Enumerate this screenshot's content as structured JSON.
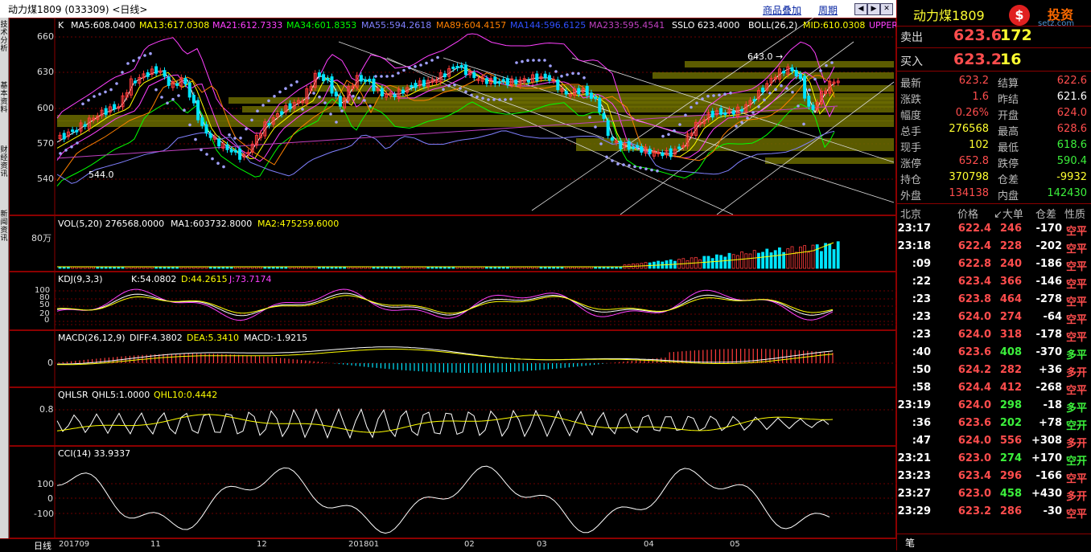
{
  "window": {
    "title": "动力煤1809 (033309) <日线>",
    "btn_overlay": "商品叠加",
    "btn_period": "周期",
    "nav_icons": [
      "prev-icon",
      "next-icon",
      "zoom-icon",
      "close-icon"
    ]
  },
  "left_tabs": [
    "技术分析",
    "基本资料",
    "财经资讯",
    "新闻资讯"
  ],
  "price_panel": {
    "prefix": "K",
    "ma5": "MA5:608.0400",
    "ma13": "MA13:617.0308",
    "ma21": "MA21:612.7333",
    "ma34": "MA34:601.8353",
    "ma55": "MA55:594.2618",
    "ma89": "MA89:604.4157",
    "ma144": "MA144:596.6125",
    "ma233": "MA233:595.4541",
    "sslo": "SSLO 623.4000",
    "boll": "BOLL(26,2)",
    "mid": "MID:610.0308",
    "upper": "UPPER",
    "y_ticks": [
      "660",
      "630",
      "600",
      "570",
      "540"
    ],
    "annot_high": "643.0 →",
    "annot_low": "544.0"
  },
  "vol_panel": {
    "label": "VOL(5,20) 276568.0000",
    "ma1": "MA1:603732.8000",
    "ma2": "MA2:475259.6000",
    "y_tick": "80万"
  },
  "kdj_panel": {
    "label": "KDJ(9,3,3)",
    "k": "K:54.0802",
    "d": "D:44.2615",
    "j": "J:73.7174",
    "y_ticks": [
      "100",
      "80",
      "50",
      "20",
      "0"
    ]
  },
  "macd_panel": {
    "label": "MACD(26,12,9)",
    "diff": "DIFF:4.3802",
    "dea": "DEA:5.3410",
    "macd": "MACD:-1.9215",
    "y_tick": "0"
  },
  "qhlsr_panel": {
    "label": "QHLSR",
    "qhl5": "QHL5:1.0000",
    "qhl10": "QHL10:0.4442",
    "y_tick": "0.8"
  },
  "cci_panel": {
    "label": "CCI(14) 33.9337",
    "y_ticks": [
      "100",
      "0",
      "-100"
    ]
  },
  "x_axis": {
    "period_tab": "日线",
    "labels": [
      "201709",
      "11",
      "12",
      "201801",
      "02",
      "03",
      "04",
      "05"
    ]
  },
  "colors": {
    "up": "#ff3b3b",
    "down": "#00e5ff",
    "ma5": "#ffffff",
    "ma13": "#ffff00",
    "ma21": "#ff40ff",
    "ma34": "#00ff00",
    "ma55": "#8080ff",
    "ma89": "#ff8000",
    "panel_border": "#8b0000"
  },
  "quote": {
    "name": "动力煤1809",
    "logo_text": "投资",
    "logo_sub": "setz.com",
    "ask_label": "卖出",
    "ask_price": "623.6",
    "ask_vol": "172",
    "bid_label": "买入",
    "bid_price": "623.2",
    "bid_vol": "16",
    "rows": [
      {
        "l1": "最新",
        "v1": "623.2",
        "c1": "red",
        "l2": "结算",
        "v2": "622.6",
        "c2": "red"
      },
      {
        "l1": "涨跌",
        "v1": "1.6",
        "c1": "red",
        "l2": "昨结",
        "v2": "621.6",
        "c2": "white"
      },
      {
        "l1": "幅度",
        "v1": "0.26%",
        "c1": "red",
        "l2": "开盘",
        "v2": "624.0",
        "c2": "red"
      },
      {
        "l1": "总手",
        "v1": "276568",
        "c1": "yel",
        "l2": "最高",
        "v2": "628.6",
        "c2": "red"
      },
      {
        "l1": "现手",
        "v1": "102",
        "c1": "yel",
        "l2": "最低",
        "v2": "618.6",
        "c2": "green"
      },
      {
        "l1": "涨停",
        "v1": "652.8",
        "c1": "red",
        "l2": "跌停",
        "v2": "590.4",
        "c2": "green"
      },
      {
        "l1": "持仓",
        "v1": "370798",
        "c1": "yel",
        "l2": "仓差",
        "v2": "-9932",
        "c2": "yel"
      },
      {
        "l1": "外盘",
        "v1": "134138",
        "c1": "red",
        "l2": "内盘",
        "v2": "142430",
        "c2": "green"
      }
    ],
    "ticks_header": [
      "北京",
      "价格",
      "↙大单",
      "仓差",
      "性质"
    ],
    "ticks": [
      {
        "time": "23:17",
        "price": "622.4",
        "vol": "246",
        "vc": "red",
        "oi": "-170",
        "nature": "空平",
        "nc": "red"
      },
      {
        "time": "23:18",
        "price": "622.4",
        "vol": "228",
        "vc": "red",
        "oi": "-202",
        "nature": "空平",
        "nc": "red"
      },
      {
        "time": ":09",
        "price": "622.8",
        "vol": "240",
        "vc": "red",
        "oi": "-186",
        "nature": "空平",
        "nc": "red"
      },
      {
        "time": ":22",
        "price": "623.4",
        "vol": "366",
        "vc": "red",
        "oi": "-146",
        "nature": "空平",
        "nc": "red"
      },
      {
        "time": ":23",
        "price": "623.8",
        "vol": "464",
        "vc": "red",
        "oi": "-278",
        "nature": "空平",
        "nc": "red"
      },
      {
        "time": ":23",
        "price": "624.0",
        "vol": "274",
        "vc": "red",
        "oi": "-64",
        "nature": "空平",
        "nc": "red"
      },
      {
        "time": ":23",
        "price": "624.0",
        "vol": "318",
        "vc": "red",
        "oi": "-178",
        "nature": "空平",
        "nc": "red"
      },
      {
        "time": ":40",
        "price": "623.6",
        "vol": "408",
        "vc": "green",
        "oi": "-370",
        "nature": "多平",
        "nc": "green"
      },
      {
        "time": ":50",
        "price": "624.2",
        "vol": "282",
        "vc": "red",
        "oi": "+36",
        "nature": "多开",
        "nc": "red"
      },
      {
        "time": ":58",
        "price": "624.4",
        "vol": "412",
        "vc": "red",
        "oi": "-268",
        "nature": "空平",
        "nc": "red"
      },
      {
        "time": "23:19",
        "price": "624.0",
        "vol": "298",
        "vc": "green",
        "oi": "-18",
        "nature": "多平",
        "nc": "green"
      },
      {
        "time": ":36",
        "price": "623.6",
        "vol": "202",
        "vc": "green",
        "oi": "+78",
        "nature": "空开",
        "nc": "green"
      },
      {
        "time": ":47",
        "price": "624.0",
        "vol": "556",
        "vc": "red",
        "oi": "+308",
        "nature": "多开",
        "nc": "red"
      },
      {
        "time": "23:21",
        "price": "623.0",
        "vol": "274",
        "vc": "green",
        "oi": "+170",
        "nature": "空开",
        "nc": "green"
      },
      {
        "time": "23:23",
        "price": "623.4",
        "vol": "296",
        "vc": "red",
        "oi": "-166",
        "nature": "空平",
        "nc": "red"
      },
      {
        "time": "23:27",
        "price": "623.0",
        "vol": "458",
        "vc": "green",
        "oi": "+430",
        "nature": "多开",
        "nc": "red"
      },
      {
        "time": "23:29",
        "price": "623.2",
        "vol": "286",
        "vc": "red",
        "oi": "-30",
        "nature": "空平",
        "nc": "red"
      }
    ],
    "bottom_tab": "笔"
  }
}
